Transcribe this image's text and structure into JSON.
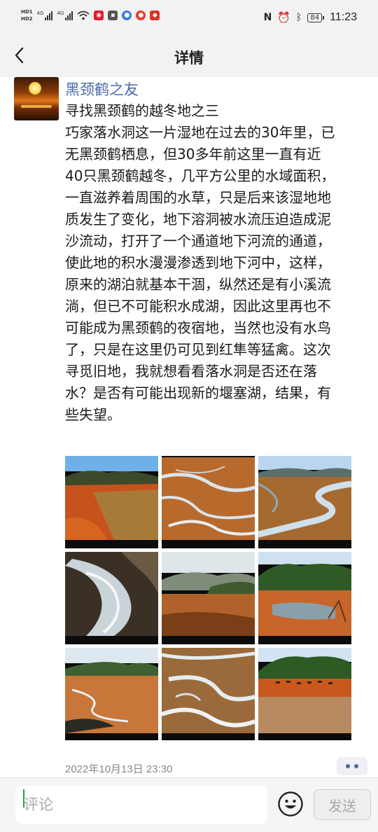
{
  "status_bar": {
    "sim1": "HD1",
    "sim2": "HD2",
    "net1": "4G",
    "net2": "4G",
    "battery": "84",
    "time": "11:23"
  },
  "header": {
    "title": "详情",
    "back_icon": "chevron-left-icon"
  },
  "post": {
    "author": "黑颈鹤之友",
    "lines": [
      "寻找黑颈鹤的越冬地之三",
      "巧家落水洞这一片湿地在过去的30年里，已",
      "无黑颈鹤栖息，但30多年前这里一直有近",
      "40只黑颈鹤越冬，几平方公里的水域面积，",
      "一直滋养着周围的水草，只是后来该湿地地",
      "质发生了变化，地下溶洞被水流压迫造成泥",
      "沙流动，打开了一个通道地下河流的通道，",
      "使此地的积水漫漫渗透到地下河中，这样，",
      "原来的湖泊就基本干涸，纵然还是有小溪流",
      "淌，但已不可能积水成湖，因此这里再也不",
      "可能成为黑颈鹤的夜宿地，当然也没有水鸟",
      "了，只是在这里仍可见到红隼等猛禽。这次",
      "寻觅旧地，我就想看看落水洞是否还在落",
      "水？是否有可能出现新的堰塞湖，结果，有",
      "些失望。"
    ],
    "photos": [
      {
        "name": "photo-red-field-hills"
      },
      {
        "name": "photo-braided-streams"
      },
      {
        "name": "photo-wetland-river-bend"
      },
      {
        "name": "photo-sunlit-water"
      },
      {
        "name": "photo-valley-dusk"
      },
      {
        "name": "photo-forest-hill-marsh"
      },
      {
        "name": "photo-meandering-stream"
      },
      {
        "name": "photo-frosted-channels"
      },
      {
        "name": "photo-cattle-on-field"
      }
    ],
    "timestamp": "2022年10月13日 23:30"
  },
  "comment_bar": {
    "placeholder": "评论",
    "send_label": "发送",
    "emoji_icon": "smiley-icon"
  },
  "colors": {
    "author_link": "#4a6aa8",
    "bar_background": "#f2f2f2"
  }
}
